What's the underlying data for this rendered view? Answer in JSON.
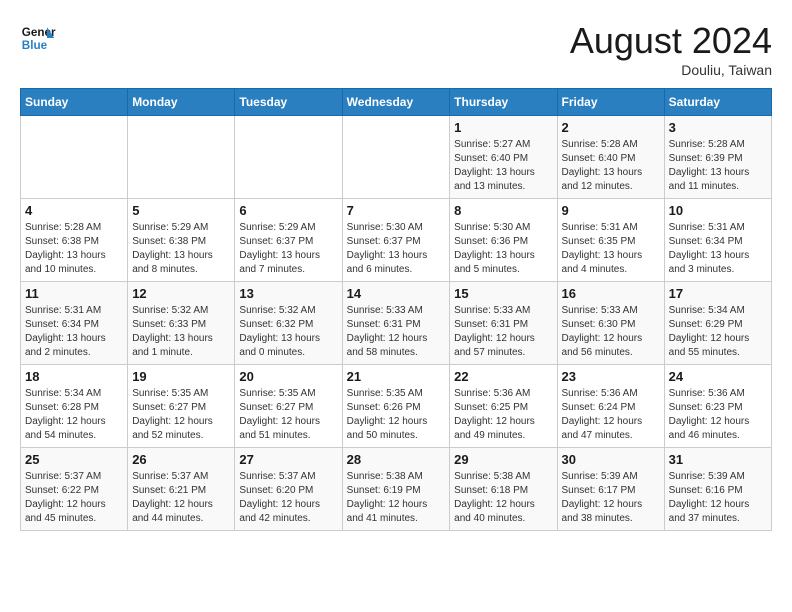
{
  "logo": {
    "line1": "General",
    "line2": "Blue"
  },
  "title": "August 2024",
  "location": "Douliu, Taiwan",
  "days_of_week": [
    "Sunday",
    "Monday",
    "Tuesday",
    "Wednesday",
    "Thursday",
    "Friday",
    "Saturday"
  ],
  "weeks": [
    [
      {
        "day": "",
        "info": ""
      },
      {
        "day": "",
        "info": ""
      },
      {
        "day": "",
        "info": ""
      },
      {
        "day": "",
        "info": ""
      },
      {
        "day": "1",
        "info": "Sunrise: 5:27 AM\nSunset: 6:40 PM\nDaylight: 13 hours\nand 13 minutes."
      },
      {
        "day": "2",
        "info": "Sunrise: 5:28 AM\nSunset: 6:40 PM\nDaylight: 13 hours\nand 12 minutes."
      },
      {
        "day": "3",
        "info": "Sunrise: 5:28 AM\nSunset: 6:39 PM\nDaylight: 13 hours\nand 11 minutes."
      }
    ],
    [
      {
        "day": "4",
        "info": "Sunrise: 5:28 AM\nSunset: 6:38 PM\nDaylight: 13 hours\nand 10 minutes."
      },
      {
        "day": "5",
        "info": "Sunrise: 5:29 AM\nSunset: 6:38 PM\nDaylight: 13 hours\nand 8 minutes."
      },
      {
        "day": "6",
        "info": "Sunrise: 5:29 AM\nSunset: 6:37 PM\nDaylight: 13 hours\nand 7 minutes."
      },
      {
        "day": "7",
        "info": "Sunrise: 5:30 AM\nSunset: 6:37 PM\nDaylight: 13 hours\nand 6 minutes."
      },
      {
        "day": "8",
        "info": "Sunrise: 5:30 AM\nSunset: 6:36 PM\nDaylight: 13 hours\nand 5 minutes."
      },
      {
        "day": "9",
        "info": "Sunrise: 5:31 AM\nSunset: 6:35 PM\nDaylight: 13 hours\nand 4 minutes."
      },
      {
        "day": "10",
        "info": "Sunrise: 5:31 AM\nSunset: 6:34 PM\nDaylight: 13 hours\nand 3 minutes."
      }
    ],
    [
      {
        "day": "11",
        "info": "Sunrise: 5:31 AM\nSunset: 6:34 PM\nDaylight: 13 hours\nand 2 minutes."
      },
      {
        "day": "12",
        "info": "Sunrise: 5:32 AM\nSunset: 6:33 PM\nDaylight: 13 hours\nand 1 minute."
      },
      {
        "day": "13",
        "info": "Sunrise: 5:32 AM\nSunset: 6:32 PM\nDaylight: 13 hours\nand 0 minutes."
      },
      {
        "day": "14",
        "info": "Sunrise: 5:33 AM\nSunset: 6:31 PM\nDaylight: 12 hours\nand 58 minutes."
      },
      {
        "day": "15",
        "info": "Sunrise: 5:33 AM\nSunset: 6:31 PM\nDaylight: 12 hours\nand 57 minutes."
      },
      {
        "day": "16",
        "info": "Sunrise: 5:33 AM\nSunset: 6:30 PM\nDaylight: 12 hours\nand 56 minutes."
      },
      {
        "day": "17",
        "info": "Sunrise: 5:34 AM\nSunset: 6:29 PM\nDaylight: 12 hours\nand 55 minutes."
      }
    ],
    [
      {
        "day": "18",
        "info": "Sunrise: 5:34 AM\nSunset: 6:28 PM\nDaylight: 12 hours\nand 54 minutes."
      },
      {
        "day": "19",
        "info": "Sunrise: 5:35 AM\nSunset: 6:27 PM\nDaylight: 12 hours\nand 52 minutes."
      },
      {
        "day": "20",
        "info": "Sunrise: 5:35 AM\nSunset: 6:27 PM\nDaylight: 12 hours\nand 51 minutes."
      },
      {
        "day": "21",
        "info": "Sunrise: 5:35 AM\nSunset: 6:26 PM\nDaylight: 12 hours\nand 50 minutes."
      },
      {
        "day": "22",
        "info": "Sunrise: 5:36 AM\nSunset: 6:25 PM\nDaylight: 12 hours\nand 49 minutes."
      },
      {
        "day": "23",
        "info": "Sunrise: 5:36 AM\nSunset: 6:24 PM\nDaylight: 12 hours\nand 47 minutes."
      },
      {
        "day": "24",
        "info": "Sunrise: 5:36 AM\nSunset: 6:23 PM\nDaylight: 12 hours\nand 46 minutes."
      }
    ],
    [
      {
        "day": "25",
        "info": "Sunrise: 5:37 AM\nSunset: 6:22 PM\nDaylight: 12 hours\nand 45 minutes."
      },
      {
        "day": "26",
        "info": "Sunrise: 5:37 AM\nSunset: 6:21 PM\nDaylight: 12 hours\nand 44 minutes."
      },
      {
        "day": "27",
        "info": "Sunrise: 5:37 AM\nSunset: 6:20 PM\nDaylight: 12 hours\nand 42 minutes."
      },
      {
        "day": "28",
        "info": "Sunrise: 5:38 AM\nSunset: 6:19 PM\nDaylight: 12 hours\nand 41 minutes."
      },
      {
        "day": "29",
        "info": "Sunrise: 5:38 AM\nSunset: 6:18 PM\nDaylight: 12 hours\nand 40 minutes."
      },
      {
        "day": "30",
        "info": "Sunrise: 5:39 AM\nSunset: 6:17 PM\nDaylight: 12 hours\nand 38 minutes."
      },
      {
        "day": "31",
        "info": "Sunrise: 5:39 AM\nSunset: 6:16 PM\nDaylight: 12 hours\nand 37 minutes."
      }
    ]
  ]
}
